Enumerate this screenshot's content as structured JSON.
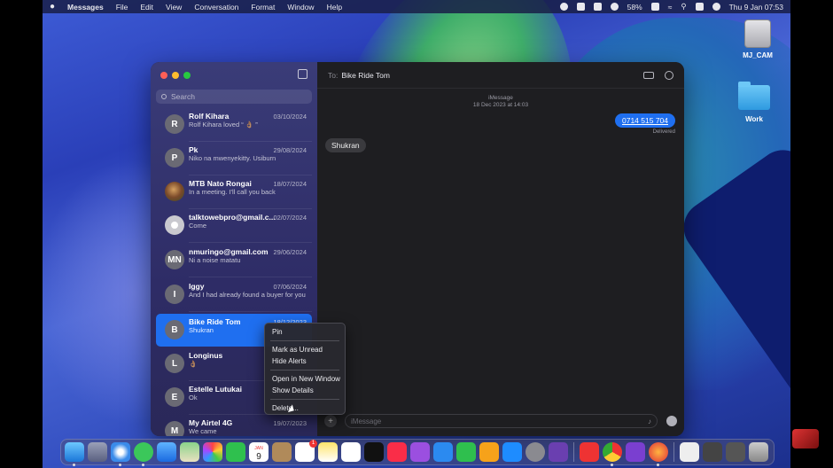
{
  "menubar": {
    "app": "Messages",
    "items": [
      "File",
      "Edit",
      "View",
      "Conversation",
      "Format",
      "Window",
      "Help"
    ],
    "battery": "58%",
    "clock": "Thu 9 Jan  07:53"
  },
  "desktop": {
    "drive_label": "MJ_CAM",
    "folder_label": "Work"
  },
  "sidebar": {
    "search_placeholder": "Search",
    "conversations": [
      {
        "initials": "R",
        "name": "Rolf Kihara",
        "date": "03/10/2024",
        "preview": "Rolf Kihara loved “ 👌🏽 ”"
      },
      {
        "initials": "P",
        "name": "Pk",
        "date": "29/08/2024",
        "preview": "Niko na mwenyekitty. Usiburn"
      },
      {
        "initials": "",
        "name": "MTB Nato Rongai",
        "date": "18/07/2024",
        "preview": "In a meeting. I'll call you back"
      },
      {
        "initials": "",
        "name": "talktowebpro@gmail.c...",
        "date": "02/07/2024",
        "preview": "Come"
      },
      {
        "initials": "MN",
        "name": "nmuringo@gmail.com",
        "date": "29/06/2024",
        "preview": "Ni a noise matatu"
      },
      {
        "initials": "I",
        "name": "Iggy",
        "date": "07/06/2024",
        "preview": "And I had already found a buyer for you"
      },
      {
        "initials": "B",
        "name": "Bike Ride Tom",
        "date": "18/12/2023",
        "preview": "Shukran"
      },
      {
        "initials": "L",
        "name": "Longinus",
        "date": "",
        "preview": "👌🏽"
      },
      {
        "initials": "E",
        "name": "Estelle Lutukai",
        "date": "",
        "preview": "Ok"
      },
      {
        "initials": "M",
        "name": "My Airtel 4G",
        "date": "19/07/2023",
        "preview": "We came"
      }
    ]
  },
  "chat": {
    "to_label": "To:",
    "recipient": "Bike Ride Tom",
    "service": "iMessage",
    "timestamp": "18 Dec 2023 at 14:03",
    "outgoing": "0714 515 704",
    "status": "Delivered",
    "incoming": "Shukran",
    "input_placeholder": "iMessage"
  },
  "context_menu": {
    "items": [
      "Pin",
      "Mark as Unread",
      "Hide Alerts",
      "Open in New Window",
      "Show Details",
      "Delete..."
    ]
  },
  "dock": {
    "calendar_day": "9",
    "calendar_month": "JAN",
    "badge_count": "1"
  },
  "colors": {
    "accent": "#1f6ff0",
    "sidebar": "#34336e",
    "chat_bg": "#1e1e21"
  }
}
